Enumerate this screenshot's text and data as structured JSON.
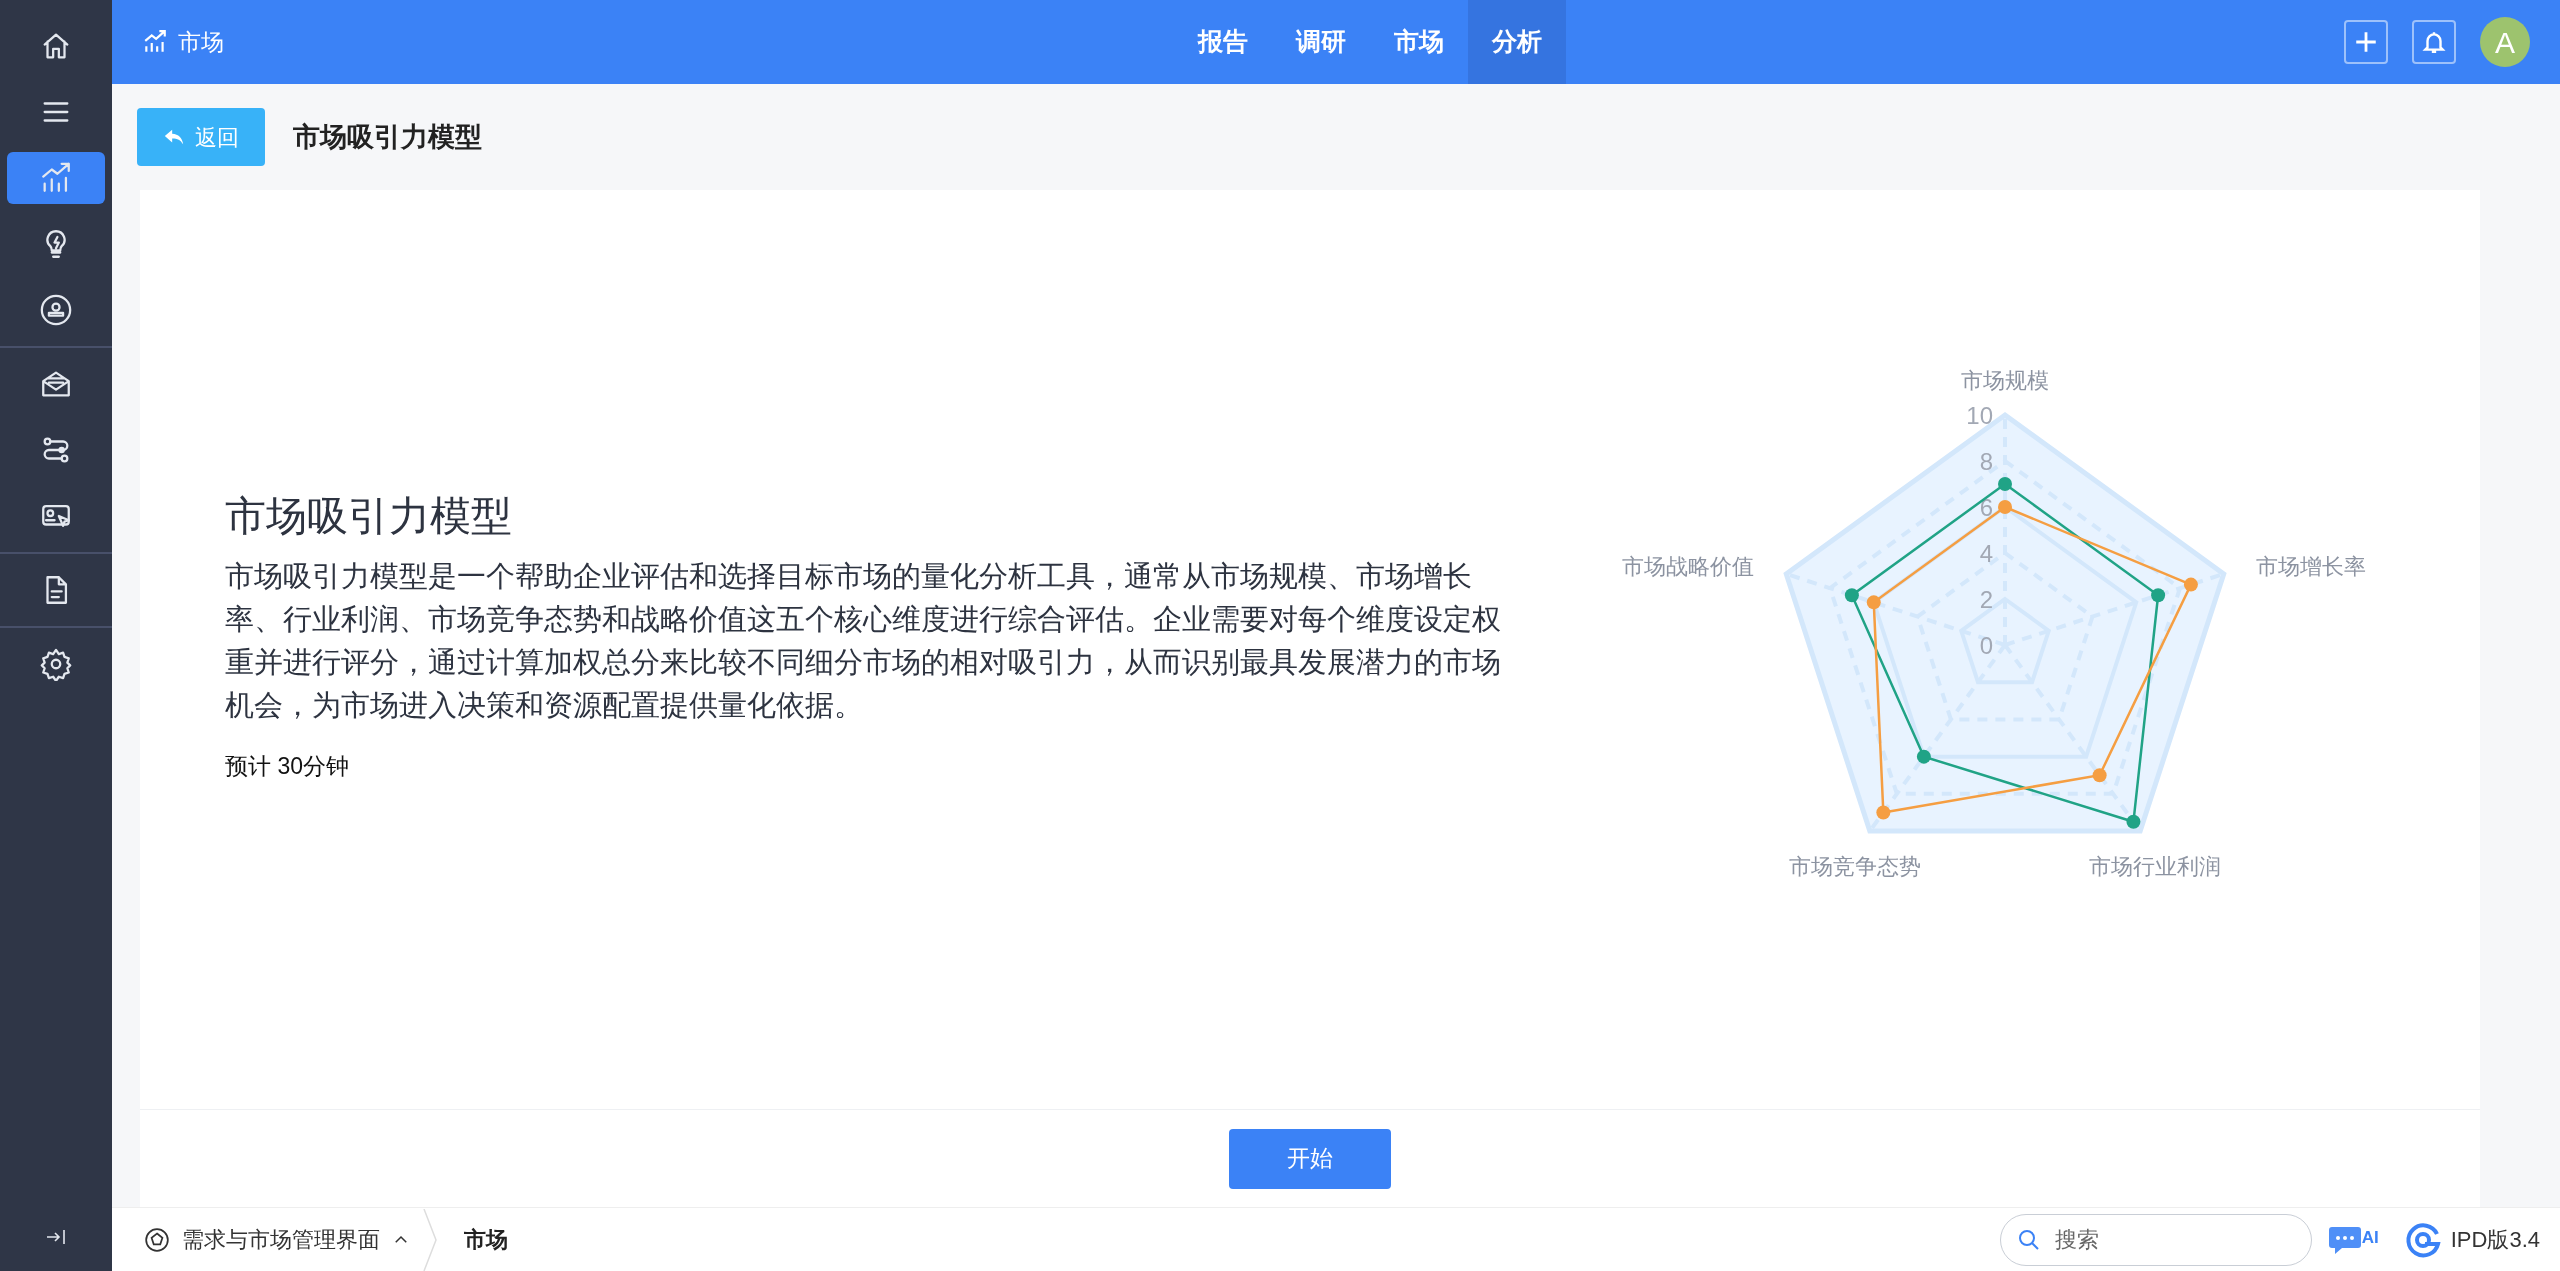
{
  "sidebar": {
    "groups": [
      {
        "items": [
          {
            "selected": false
          },
          {
            "selected": false
          },
          {
            "selected": true
          },
          {
            "selected": false
          },
          {
            "selected": false
          }
        ]
      },
      {
        "items": [
          {
            "selected": false
          },
          {
            "selected": false
          },
          {
            "selected": false
          }
        ]
      },
      {
        "items": [
          {
            "selected": false
          }
        ]
      },
      {
        "items": [
          {
            "selected": false
          }
        ]
      }
    ]
  },
  "header": {
    "title": "市场",
    "nav": [
      {
        "label": "报告",
        "selected": false
      },
      {
        "label": "调研",
        "selected": false
      },
      {
        "label": "市场",
        "selected": false
      },
      {
        "label": "分析",
        "selected": true
      }
    ],
    "avatar": "A"
  },
  "page": {
    "back_button": "返回",
    "title": "市场吸引力模型"
  },
  "intro": {
    "heading": "市场吸引力模型",
    "description": "市场吸引力模型是一个帮助企业评估和选择目标市场的量化分析工具，通常从市场规模、市场增长率、行业利润、市场竞争态势和战略价值这五个核心维度进行综合评估。企业需要对每个维度设定权重并进行评分，通过计算加权总分来比较不同细分市场的相对吸引力，从而识别最具发展潜力的市场机会，为市场进入决策和资源配置提供量化依据。",
    "duration": "预计 30分钟"
  },
  "chart_data": {
    "type": "radar",
    "categories": [
      "市场规模",
      "市场增长率",
      "市场行业利润",
      "市场竞争态势",
      "市场战略价值"
    ],
    "ylim": [
      0,
      10
    ],
    "yticks": [
      0,
      2,
      4,
      6,
      8,
      10
    ],
    "series": [
      {
        "color": "#20a386",
        "values": [
          7,
          7,
          9.5,
          6,
          7
        ]
      },
      {
        "color": "#f59e42",
        "values": [
          6,
          8.5,
          7,
          9,
          6
        ]
      }
    ]
  },
  "start_button": "开始",
  "status_bar": {
    "breadcrumb": [
      {
        "label": "需求与市场管理界面"
      },
      {
        "label": "市场"
      }
    ],
    "search": {
      "placeholder": "搜索"
    },
    "ai_badge": "AI",
    "version": "IPD版3.4"
  }
}
